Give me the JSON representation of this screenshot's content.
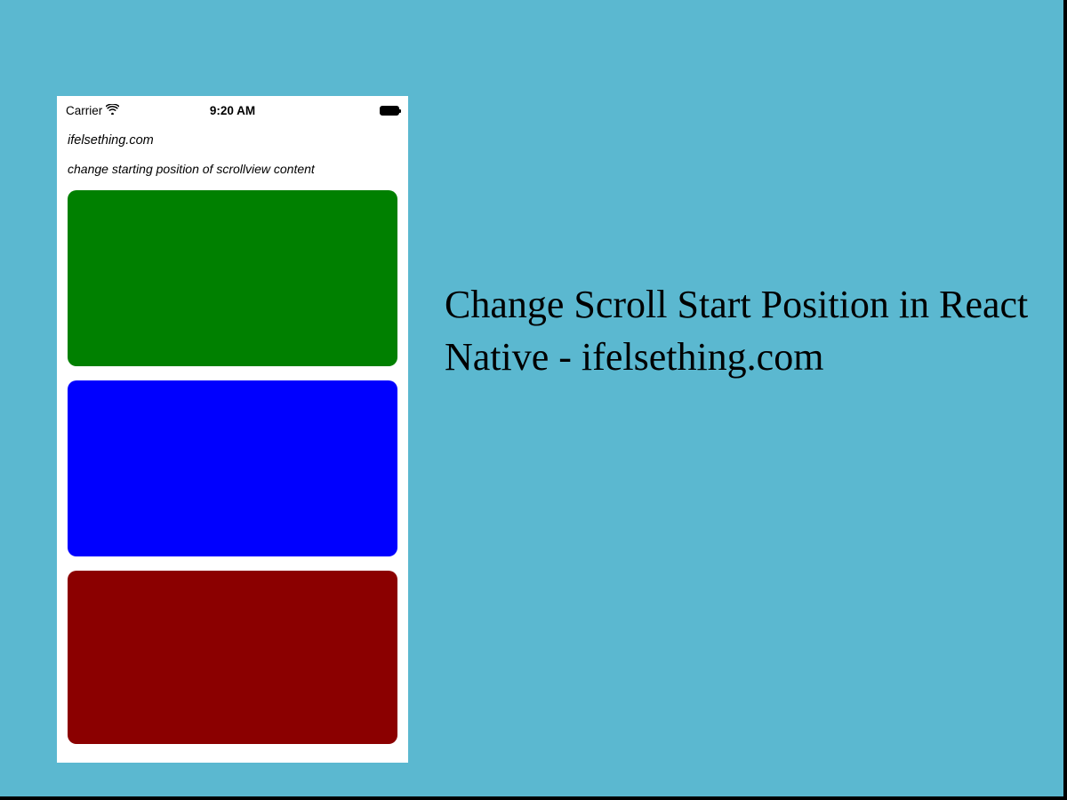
{
  "status_bar": {
    "carrier": "Carrier",
    "time": "9:20 AM"
  },
  "app": {
    "site_label": "ifelsething.com",
    "subtitle": "change starting position of scrollview content",
    "blocks": [
      {
        "color": "green"
      },
      {
        "color": "blue"
      },
      {
        "color": "darkred"
      }
    ]
  },
  "headline": "Change Scroll Start Position in React Native - ifelsething.com",
  "colors": {
    "canvas_bg": "#5bb8d0",
    "block_green": "#008000",
    "block_blue": "#0000ff",
    "block_darkred": "#8b0000"
  }
}
